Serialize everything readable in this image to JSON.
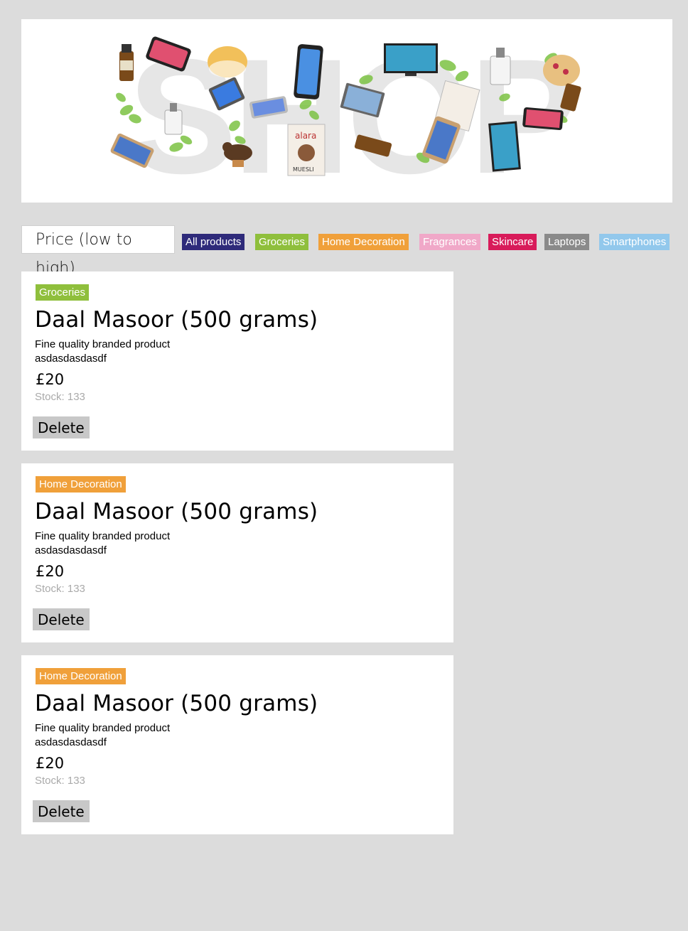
{
  "banner": {
    "word": "SHOP"
  },
  "sort": {
    "selected": "Price (low to high)"
  },
  "filters": [
    {
      "label": "All products",
      "color": "#2e2a7a"
    },
    {
      "label": "Groceries",
      "color": "#8fbf3c"
    },
    {
      "label": "Home Decoration",
      "color": "#f0a03a"
    },
    {
      "label": "Fragrances",
      "color": "#f0a8c8"
    },
    {
      "label": "Skincare",
      "color": "#d81b5a"
    },
    {
      "label": "Laptops",
      "color": "#8a8a8a"
    },
    {
      "label": "Smartphones",
      "color": "#92c8ec"
    }
  ],
  "products": [
    {
      "category": "Groceries",
      "category_color": "#8fbf3c",
      "title": "Daal Masoor (500 grams)",
      "desc_line1": "Fine quality branded product",
      "desc_line2": "asdasdasdasdf",
      "price": "£20",
      "stock": "Stock: 133",
      "delete_label": "Delete"
    },
    {
      "category": "Home Decoration",
      "category_color": "#f0a03a",
      "title": "Daal Masoor (500 grams)",
      "desc_line1": "Fine quality branded product",
      "desc_line2": "asdasdasdasdf",
      "price": "£20",
      "stock": "Stock: 133",
      "delete_label": "Delete"
    },
    {
      "category": "Home Decoration",
      "category_color": "#f0a03a",
      "title": "Daal Masoor (500 grams)",
      "desc_line1": "Fine quality branded product",
      "desc_line2": "asdasdasdasdf",
      "price": "£20",
      "stock": "Stock: 133",
      "delete_label": "Delete"
    }
  ]
}
